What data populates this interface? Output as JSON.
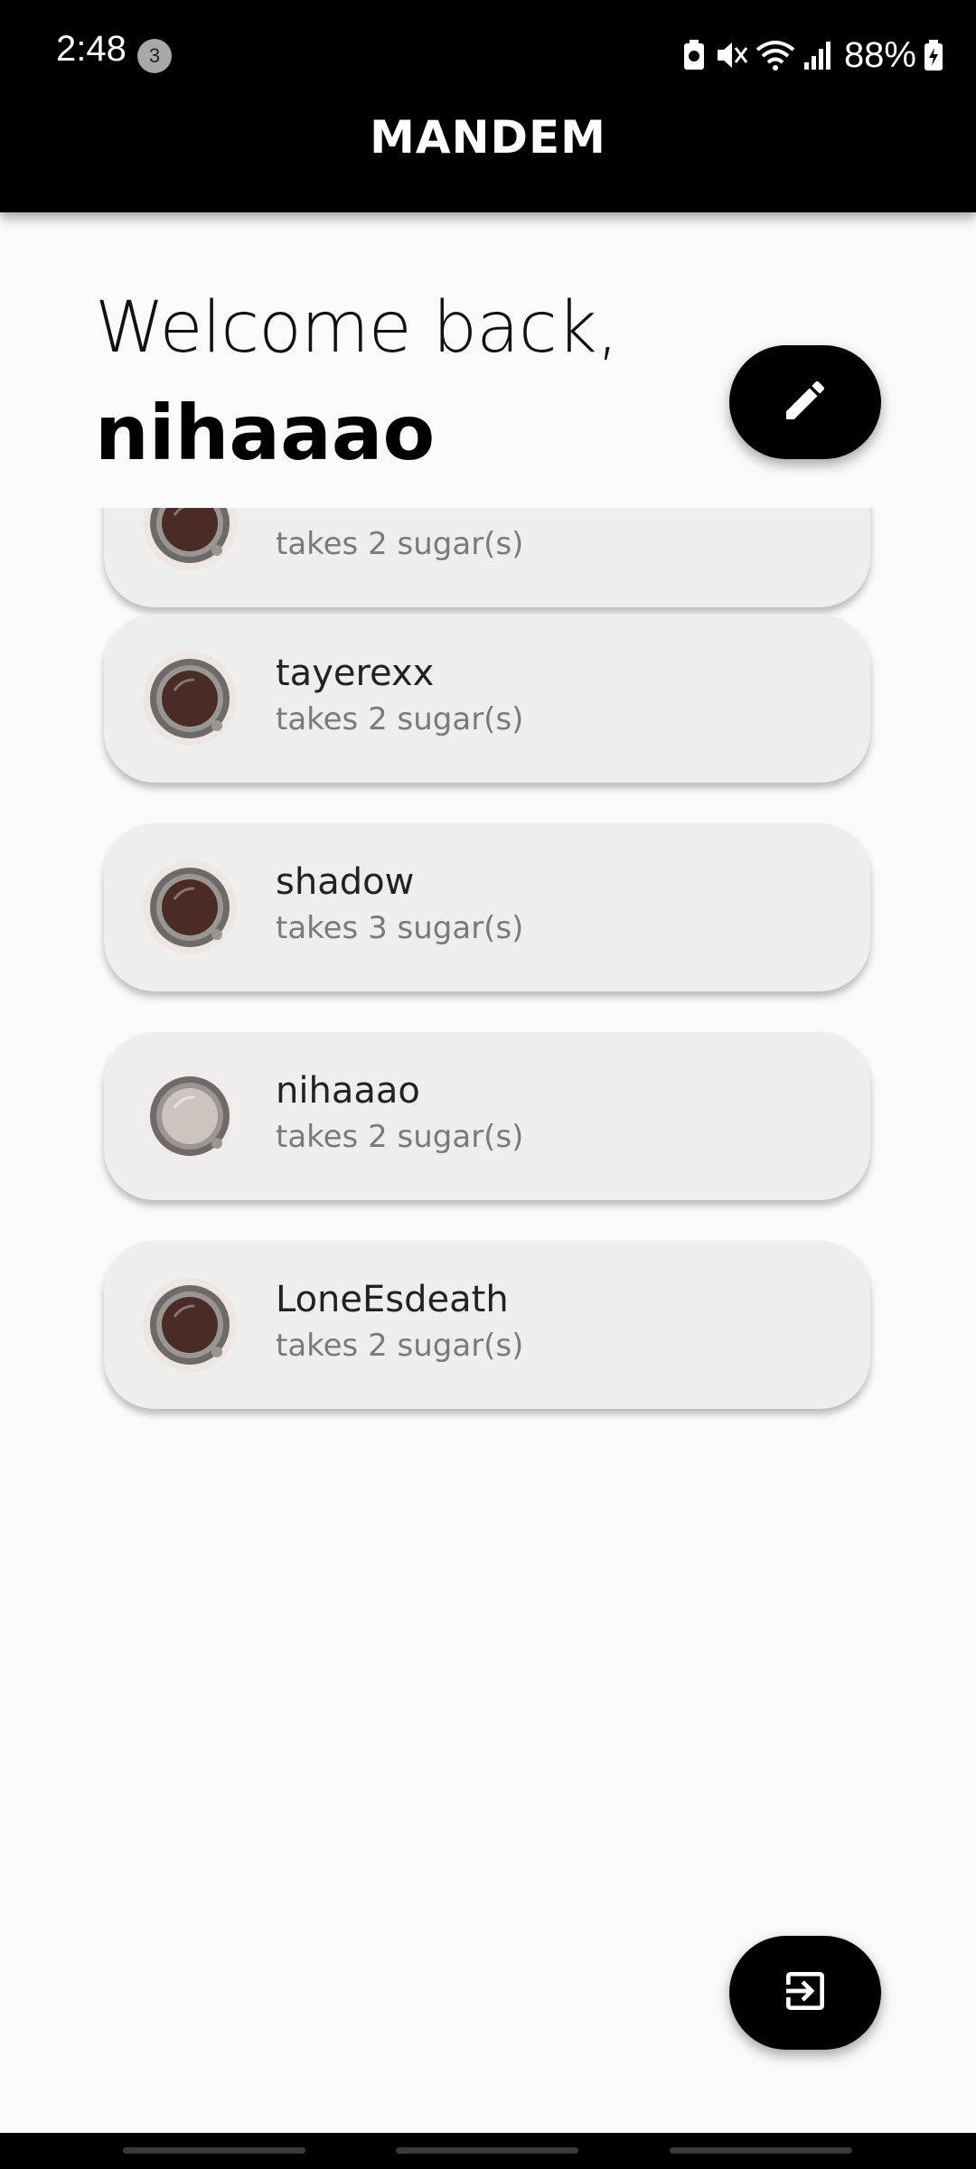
{
  "status_bar": {
    "time": "2:48",
    "notification_count": "3",
    "battery": "88%"
  },
  "app_bar": {
    "title": "MANDEM"
  },
  "welcome": {
    "greeting": "Welcome back,",
    "username": "nihaaao"
  },
  "list": [
    {
      "name": "",
      "sugar": "takes 2 sugar(s)",
      "coffee": "dark"
    },
    {
      "name": "tayerexx",
      "sugar": "takes 2 sugar(s)",
      "coffee": "dark"
    },
    {
      "name": "shadow",
      "sugar": "takes 3 sugar(s)",
      "coffee": "dark"
    },
    {
      "name": "nihaaao",
      "sugar": "takes 2 sugar(s)",
      "coffee": "milky"
    },
    {
      "name": "LoneEsdeath",
      "sugar": "takes 2 sugar(s)",
      "coffee": "dark"
    }
  ],
  "icons": {
    "edit": "edit-pencil-icon",
    "logout": "logout-icon",
    "coffee": "coffee-cup-icon"
  },
  "colors": {
    "appbar": "#000000",
    "background": "#fafafa",
    "card": "#eeeeee",
    "dark_coffee": "#4a2b26",
    "milky_coffee": "#cfc3c0"
  }
}
